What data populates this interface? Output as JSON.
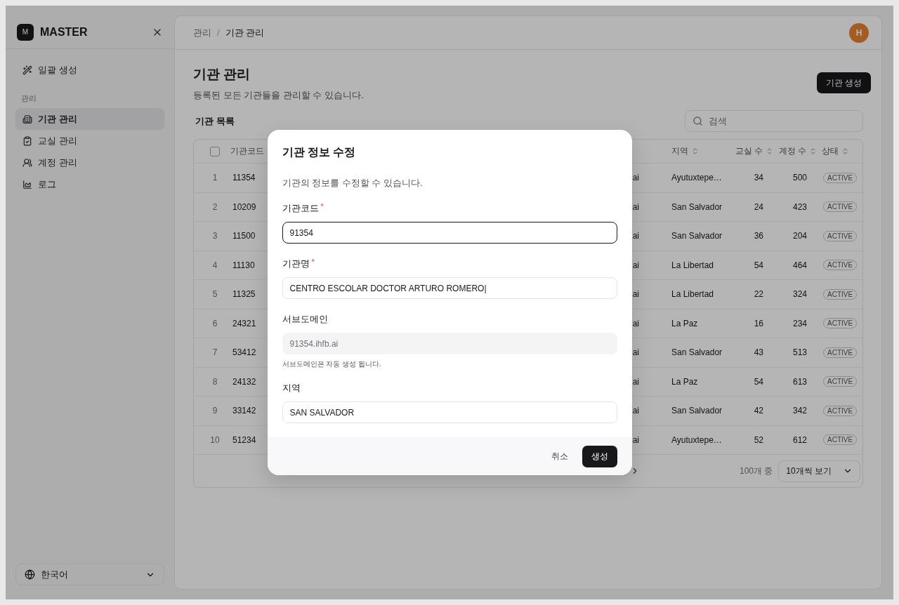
{
  "sidebar": {
    "logo": {
      "mark": "M",
      "name": "MASTER"
    },
    "items": [
      {
        "label": "일괄 생성",
        "selected": false
      }
    ],
    "section": {
      "label": "관리",
      "items": [
        {
          "label": "기관 관리",
          "selected": true
        },
        {
          "label": "교실 관리",
          "selected": false
        },
        {
          "label": "계정 관리",
          "selected": false
        },
        {
          "label": "로그",
          "selected": false
        }
      ]
    },
    "language": "한국어"
  },
  "header": {
    "breadcrumb": [
      "관리",
      "기관 관리"
    ],
    "separator": "/",
    "avatar": "H"
  },
  "page": {
    "title": "기관 관리",
    "subtitle": "등록된 모든 기관들을 관리할 수 있습니다.",
    "create_button": "기관 생성",
    "list_title": "기관 목록",
    "search": {
      "placeholder": "검색"
    }
  },
  "table": {
    "select_all": {
      "checked": false
    },
    "columns": [
      {
        "label": "기관코드"
      },
      {
        "label": "지역"
      },
      {
        "label": "교실 수"
      },
      {
        "label": "계정 수"
      },
      {
        "label": "상태"
      }
    ],
    "rows": [
      {
        "index": "1",
        "code": "11354",
        "subdomain": "ai",
        "region": "Ayutuxtepe…",
        "classrooms": "34",
        "accounts": "500",
        "status": "ACTIVE"
      },
      {
        "index": "2",
        "code": "10209",
        "subdomain": "ai",
        "region": "San Salvador",
        "classrooms": "24",
        "accounts": "423",
        "status": "ACTIVE"
      },
      {
        "index": "3",
        "code": "11500",
        "subdomain": "ai",
        "region": "San Salvador",
        "classrooms": "36",
        "accounts": "204",
        "status": "ACTIVE"
      },
      {
        "index": "4",
        "code": "11130",
        "subdomain": "ai",
        "region": "La Libertad",
        "classrooms": "54",
        "accounts": "464",
        "status": "ACTIVE"
      },
      {
        "index": "5",
        "code": "11325",
        "subdomain": "ai",
        "region": "La Libertad",
        "classrooms": "22",
        "accounts": "324",
        "status": "ACTIVE"
      },
      {
        "index": "6",
        "code": "24321",
        "subdomain": "ai",
        "region": "La Paz",
        "classrooms": "16",
        "accounts": "234",
        "status": "ACTIVE"
      },
      {
        "index": "7",
        "code": "53412",
        "subdomain": "ai",
        "region": "San Salvador",
        "classrooms": "43",
        "accounts": "513",
        "status": "ACTIVE"
      },
      {
        "index": "8",
        "code": "24132",
        "subdomain": "ai",
        "region": "La Paz",
        "classrooms": "54",
        "accounts": "613",
        "status": "ACTIVE"
      },
      {
        "index": "9",
        "code": "33142",
        "subdomain": "ai",
        "region": "San Salvador",
        "classrooms": "42",
        "accounts": "342",
        "status": "ACTIVE"
      },
      {
        "index": "10",
        "code": "51234",
        "subdomain": "ai",
        "region": "Ayutuxtepe…",
        "classrooms": "52",
        "accounts": "612",
        "status": "ACTIVE"
      }
    ],
    "footer": {
      "total": "100개 중",
      "page_size": "10개씩 보기"
    }
  },
  "modal": {
    "title": "기관 정보 수정",
    "description": "기관의 정보를 수정할 수 있습니다.",
    "fields": [
      {
        "label": "기관코드",
        "required_mark": "*",
        "value": "91354",
        "focused": true,
        "disabled": false
      },
      {
        "label": "기관명",
        "required_mark": "*",
        "value": "CENTRO ESCOLAR DOCTOR ARTURO ROMERO|",
        "focused": false,
        "disabled": false
      },
      {
        "label": "서브도메인",
        "value": "91354.ihfb.ai",
        "focused": false,
        "disabled": true,
        "help": "서브도메인은 자동 생성 됩니다."
      },
      {
        "label": "지역",
        "value": "SAN SALVADOR",
        "focused": false,
        "disabled": false
      }
    ],
    "cancel": "취소",
    "submit": "생성"
  }
}
